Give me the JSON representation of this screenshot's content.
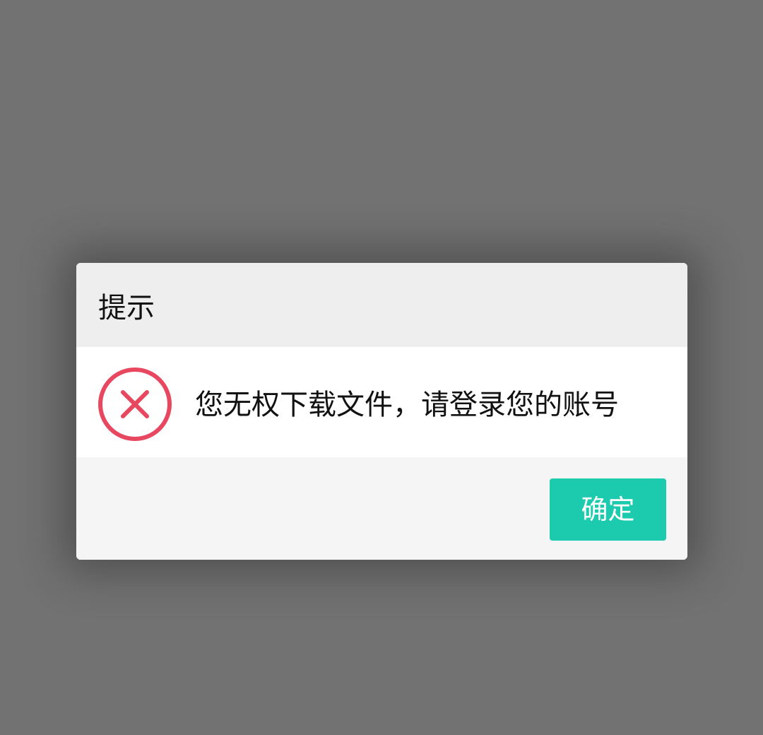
{
  "dialog": {
    "title": "提示",
    "icon": "error-circle-x-icon",
    "message": "您无权下载文件，请登录您的账号",
    "confirm_label": "确定"
  },
  "colors": {
    "overlay": "#727272",
    "header_bg": "#eeeeee",
    "body_bg": "#ffffff",
    "footer_bg": "#f5f5f5",
    "error_red": "#e8485f",
    "button_teal": "#1ccbad"
  }
}
